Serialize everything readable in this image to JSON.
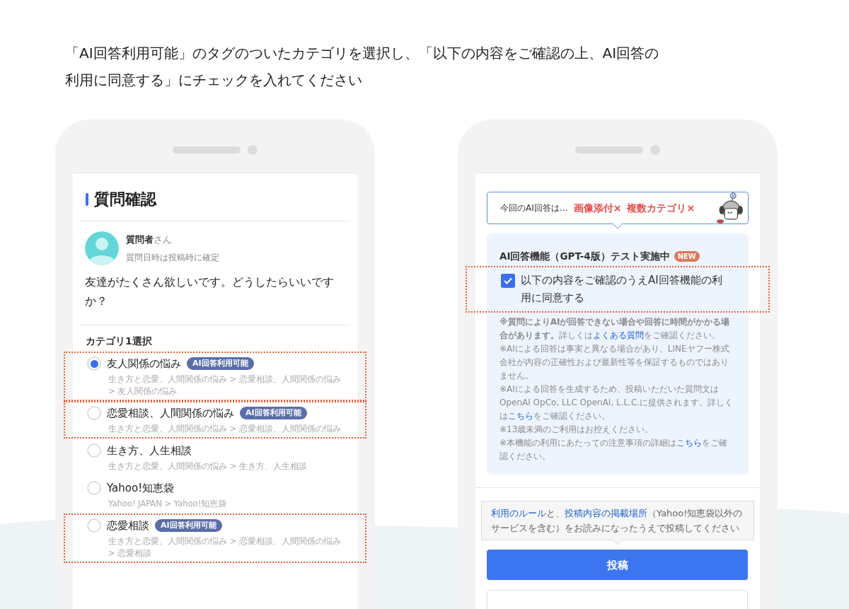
{
  "instruction": [
    "「AI回答利用可能」のタグのついたカテゴリを選択し、「以下の内容をご確認の上、AI回答の",
    "利用に同意する」にチェックを入れてください"
  ],
  "left_phone": {
    "title": "質問確認",
    "asker": {
      "name": "質問者",
      "suffix": "さん",
      "date": "質問日時は投稿時に確定"
    },
    "question": "友達がたくさん欲しいです。どうしたらいいですか？",
    "category_heading": "カテゴリ1選択",
    "categories": [
      {
        "label": "友人関係の悩み",
        "tag": "AI回答利用可能",
        "path": "生き方と恋愛、人間関係の悩み > 恋愛相談、人間関係の悩み > 友人関係の悩み",
        "selected": true,
        "highlighted": true
      },
      {
        "label": "恋愛相談、人間関係の悩み",
        "tag": "AI回答利用可能",
        "path": "生き方と恋愛、人間関係の悩み > 恋愛相談、人間関係の悩み",
        "selected": false,
        "highlighted": true
      },
      {
        "label": "生き方、人生相談",
        "path": "生き方と恋愛、人間関係の悩み > 生き方、人生相談",
        "selected": false,
        "highlighted": false
      },
      {
        "label": "Yahoo!知恵袋",
        "path": "Yahoo! JAPAN > Yahoo!知恵袋",
        "selected": false,
        "highlighted": false
      },
      {
        "label": "恋愛相談",
        "tag": "AI回答利用可能",
        "path": "生き方と恋愛、人間関係の悩み > 恋愛相談、人間関係の悩み > 恋愛相談",
        "selected": false,
        "highlighted": true
      }
    ]
  },
  "right_phone": {
    "banner": {
      "prefix": "今回のAI回答は…",
      "items": [
        "画像添付×",
        "複数カテゴリ×"
      ]
    },
    "ai_panel": {
      "title": "AI回答機能（GPT-4版）テスト実施中",
      "badge": "NEW",
      "consent": {
        "label": "以下の内容をご確認のうえAI回答機能の利用に同意する",
        "checked": true,
        "highlighted": true
      },
      "notes": [
        [
          {
            "kind": "bold",
            "text": "※質問によりAIが回答できない場合や回答に時間がかかる場合があります。"
          },
          {
            "kind": "text",
            "text": "詳しくは"
          },
          {
            "kind": "link",
            "text": "よくある質問"
          },
          {
            "kind": "text",
            "text": "をご確認ください。"
          }
        ],
        [
          {
            "kind": "text",
            "text": "※AIによる回答は事実と異なる場合があり、LINEヤフー株式会社が内容の正確性および最新性等を保証するものではありません。"
          }
        ],
        [
          {
            "kind": "text",
            "text": "※AIによる回答を生成するため、投稿いただいた質問文はOpenAI OpCo, LLC OpenAI, L.L.C.に提供されます。詳しくは"
          },
          {
            "kind": "link",
            "text": "こちら"
          },
          {
            "kind": "text",
            "text": "をご確認ください。"
          }
        ],
        [
          {
            "kind": "text",
            "text": "※13歳未満のご利用はお控えください。"
          }
        ],
        [
          {
            "kind": "text",
            "text": "※本機能の利用にあたっての注意事項の詳細は"
          },
          {
            "kind": "link",
            "text": "こちら"
          },
          {
            "kind": "text",
            "text": "をご確認ください。"
          }
        ]
      ]
    },
    "terms": [
      {
        "kind": "link",
        "text": "利用のルール"
      },
      {
        "kind": "text",
        "text": "と、"
      },
      {
        "kind": "link",
        "text": "投稿内容の掲載場所"
      },
      {
        "kind": "text",
        "text": "（Yahoo!知恵袋以外のサービスを含む）をお読みになったうえで投稿してください"
      }
    ],
    "submit_button": "投稿"
  }
}
